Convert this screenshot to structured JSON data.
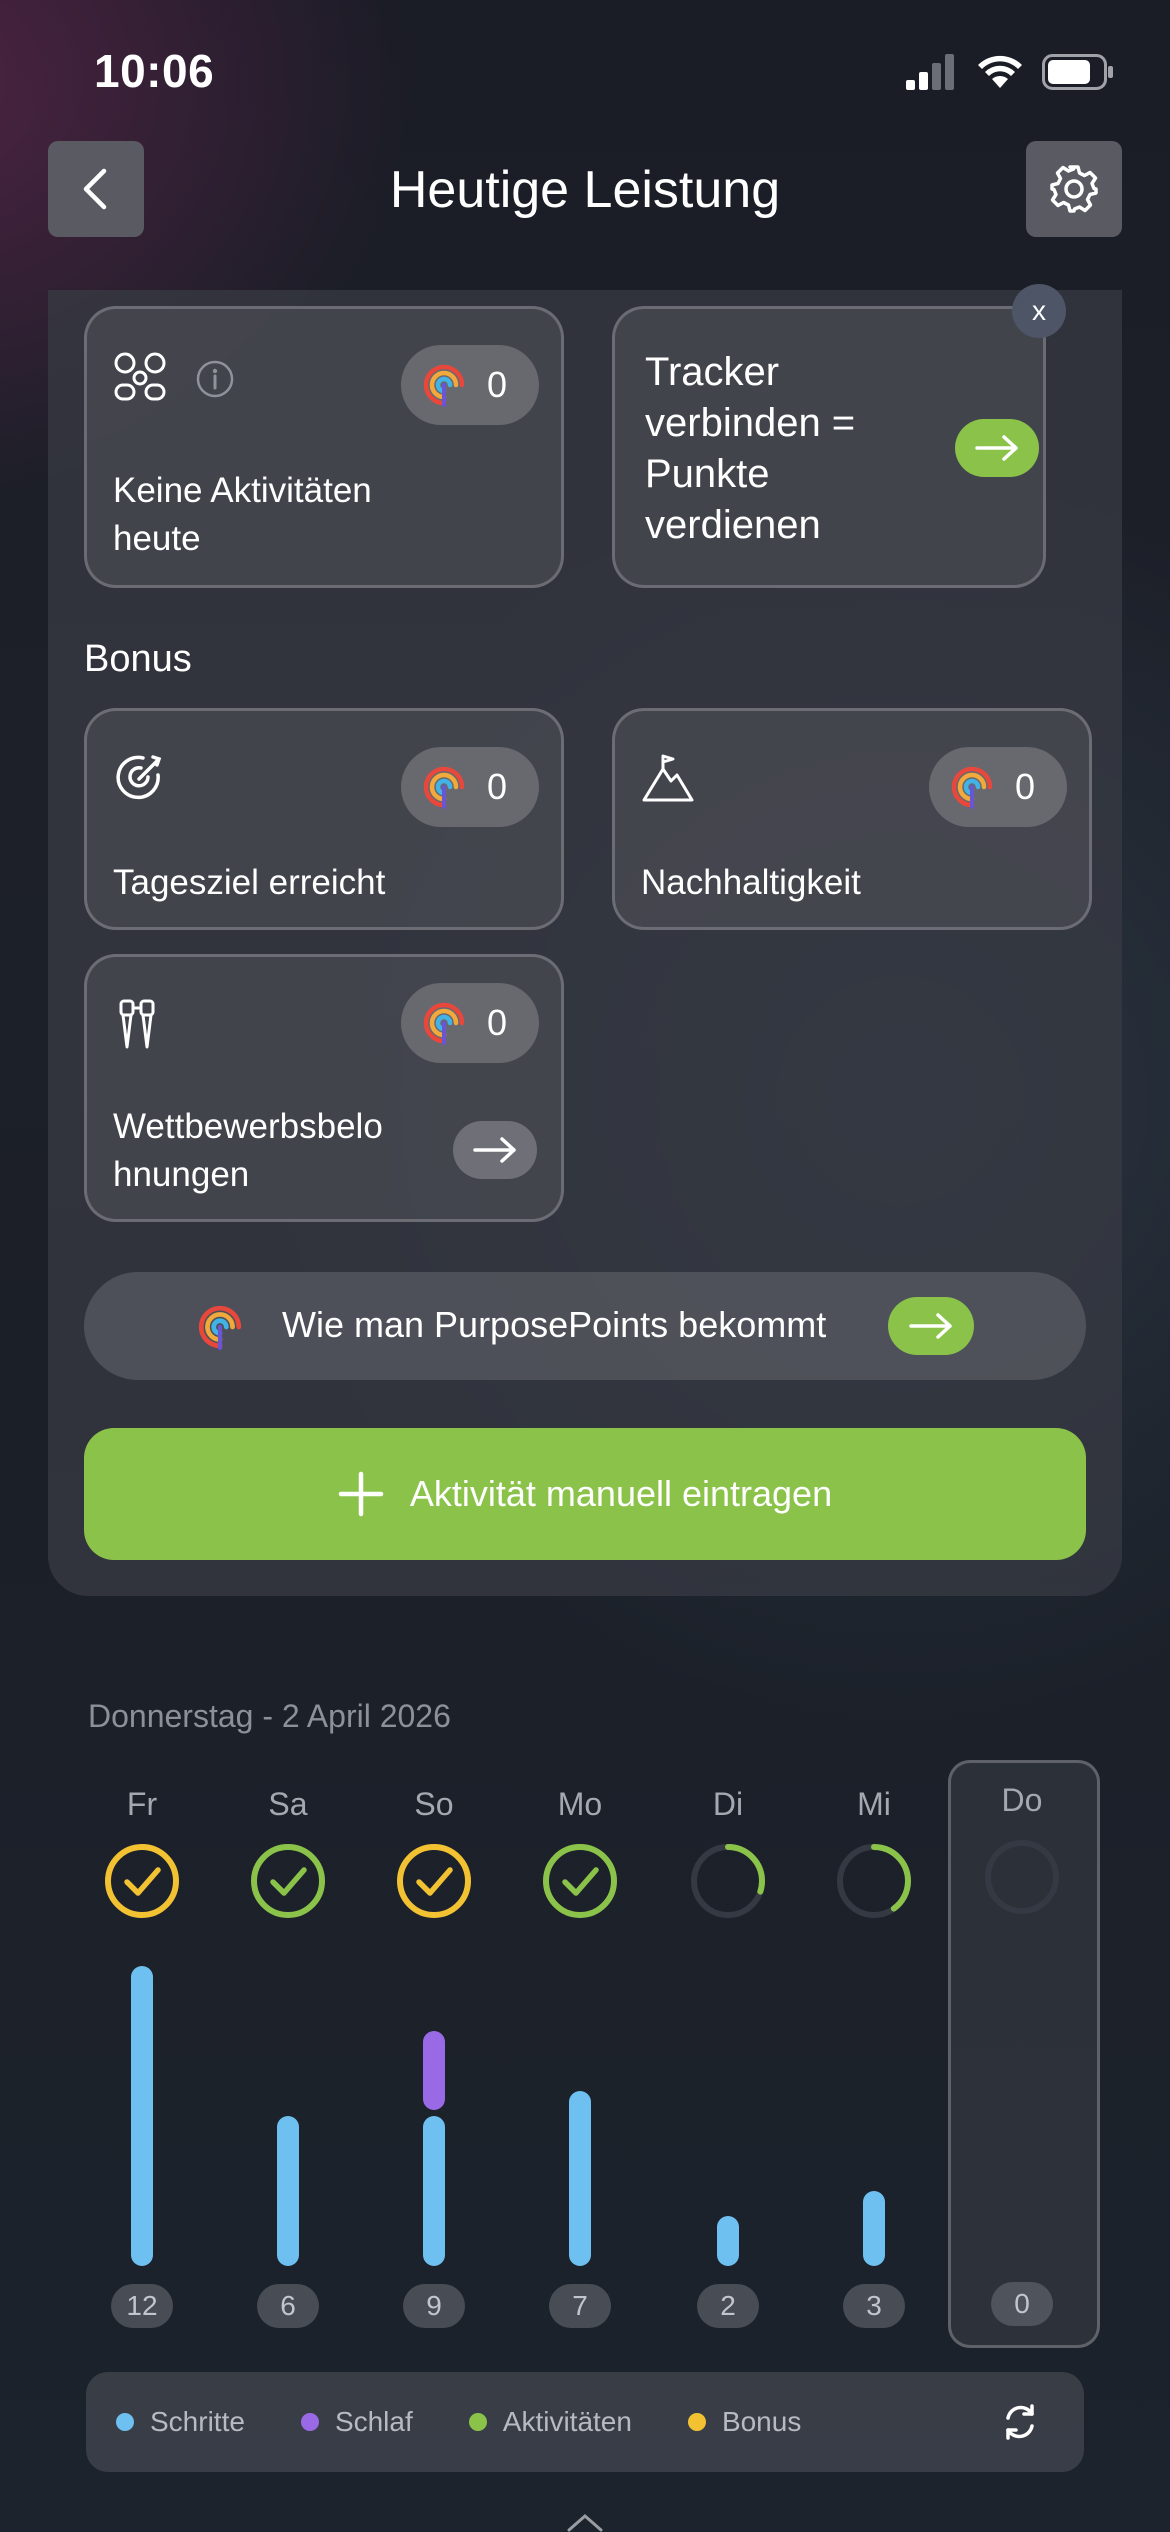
{
  "status_bar": {
    "time": "10:06"
  },
  "header": {
    "title": "Heutige Leistung"
  },
  "activity_card": {
    "label": "Keine Aktivitäten heute",
    "points": "0"
  },
  "tracker_card": {
    "label": "Tracker verbinden = Punkte verdienen",
    "close": "x"
  },
  "bonus": {
    "title": "Bonus",
    "goal": {
      "label": "Tagesziel erreicht",
      "points": "0"
    },
    "sustain": {
      "label": "Nachhaltigkeit",
      "points": "0"
    },
    "competition": {
      "label": "Wettbewerbsbelohnungen",
      "points": "0"
    }
  },
  "how_to": {
    "label": "Wie man PurposePoints bekommt"
  },
  "manual_entry": {
    "label": "Aktivität manuell eintragen"
  },
  "week": {
    "date": "Donnerstag - 2 April 2026",
    "days": [
      {
        "label": "Fr",
        "status": "bonus-done",
        "steps": 12,
        "sleep": 0,
        "count": "12"
      },
      {
        "label": "Sa",
        "status": "activity-done",
        "steps": 6,
        "sleep": 0,
        "count": "6"
      },
      {
        "label": "So",
        "status": "bonus-done",
        "steps": 6,
        "sleep": 3,
        "count": "9"
      },
      {
        "label": "Mo",
        "status": "activity-done",
        "steps": 7,
        "sleep": 0,
        "count": "7"
      },
      {
        "label": "Di",
        "status": "partial",
        "progress": 0.3,
        "steps": 2,
        "sleep": 0,
        "count": "2"
      },
      {
        "label": "Mi",
        "status": "partial",
        "progress": 0.4,
        "steps": 3,
        "sleep": 0,
        "count": "3"
      },
      {
        "label": "Do",
        "status": "empty",
        "steps": 0,
        "sleep": 0,
        "count": "0"
      }
    ]
  },
  "legend": {
    "steps": "Schritte",
    "sleep": "Schlaf",
    "activities": "Aktivitäten",
    "bonus": "Bonus"
  },
  "colors": {
    "steps": "#6ec0f0",
    "sleep": "#9a6ae6",
    "activities": "#8bc34a",
    "bonus": "#f2c233"
  }
}
